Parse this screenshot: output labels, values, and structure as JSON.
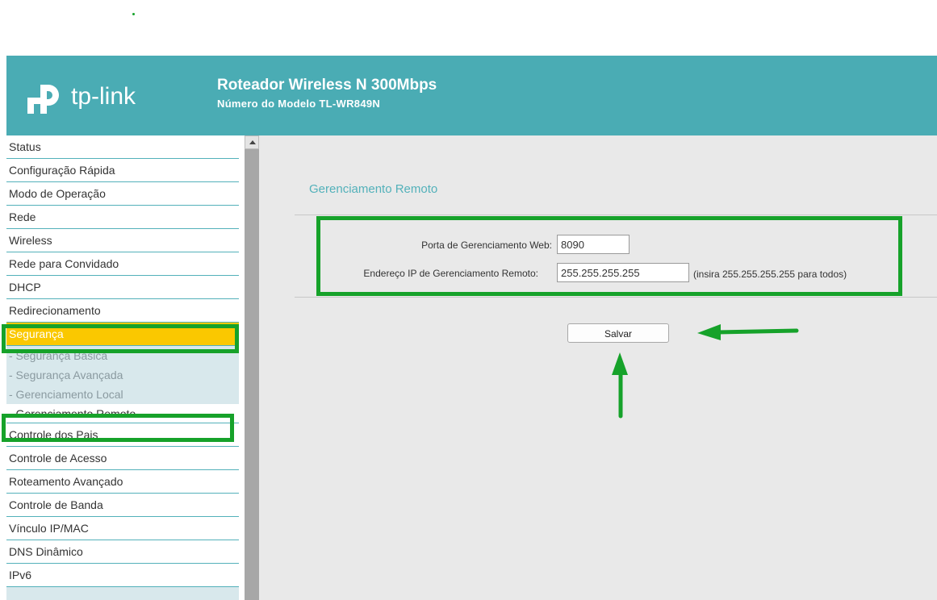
{
  "header": {
    "logo_text": "tp-link",
    "title": "Roteador Wireless N 300Mbps",
    "subtitle": "Número do Modelo TL-WR849N"
  },
  "sidebar": {
    "items": [
      {
        "label": "Status",
        "type": "main"
      },
      {
        "label": "Configuração Rápida",
        "type": "main"
      },
      {
        "label": "Modo de Operação",
        "type": "main"
      },
      {
        "label": "Rede",
        "type": "main"
      },
      {
        "label": "Wireless",
        "type": "main"
      },
      {
        "label": "Rede para Convidado",
        "type": "main"
      },
      {
        "label": "DHCP",
        "type": "main"
      },
      {
        "label": "Redirecionamento",
        "type": "main"
      },
      {
        "label": "Segurança",
        "type": "main",
        "active": true
      },
      {
        "label": "- Segurança Básica",
        "type": "sub"
      },
      {
        "label": "- Segurança Avançada",
        "type": "sub"
      },
      {
        "label": "- Gerenciamento Local",
        "type": "sub"
      },
      {
        "label": "- Gerenciamento Remoto",
        "type": "sub",
        "current": true
      },
      {
        "label": "Controle dos Pais",
        "type": "main"
      },
      {
        "label": "Controle de Acesso",
        "type": "main"
      },
      {
        "label": "Roteamento Avançado",
        "type": "main"
      },
      {
        "label": "Controle de Banda",
        "type": "main"
      },
      {
        "label": "Vínculo IP/MAC",
        "type": "main"
      },
      {
        "label": "DNS Dinâmico",
        "type": "main"
      },
      {
        "label": "IPv6",
        "type": "main"
      }
    ]
  },
  "main": {
    "section_title": "Gerenciamento Remoto",
    "port_label": "Porta de Gerenciamento Web:",
    "port_value": "8090",
    "ip_label": "Endereço IP de Gerenciamento Remoto:",
    "ip_value": "255.255.255.255",
    "ip_hint": "(insira 255.255.255.255 para todos)",
    "save_label": "Salvar"
  },
  "colors": {
    "header_bg": "#4aacb4",
    "accent_teal": "#53b1ba",
    "active_yellow": "#fac800",
    "annotation_green": "#16a22a"
  },
  "icons": [
    "tp-link-logo-icon",
    "scroll-up-arrow-icon",
    "annotation-arrow-left-icon",
    "annotation-arrow-up-icon"
  ]
}
